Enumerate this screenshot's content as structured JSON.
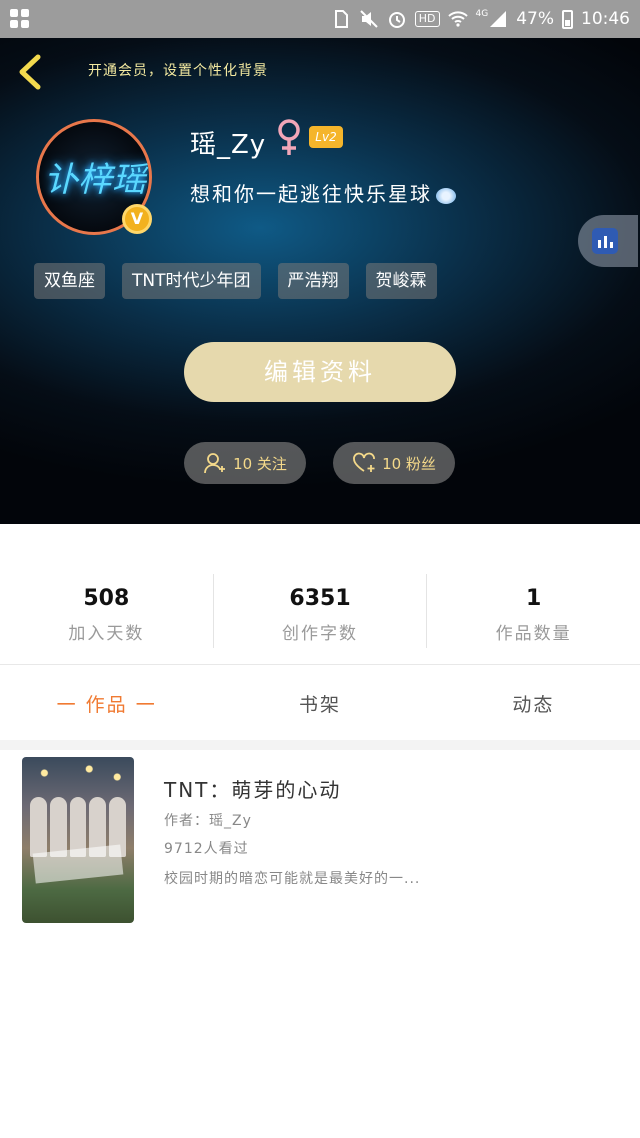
{
  "status_bar": {
    "battery": "47%",
    "time": "10:46",
    "hd": "HD",
    "network": "4G"
  },
  "header": {
    "vip_tip": "开通会员，设置个性化背景"
  },
  "profile": {
    "avatar_text": "讣梓瑶",
    "username": "瑶_Zy",
    "level": "Lv2",
    "bio": "想和你一起逃往快乐星球",
    "vip_badge": "V",
    "tags": [
      "双鱼座",
      "TNT时代少年团",
      "严浩翔",
      "贺峻霖"
    ],
    "edit_label": "编辑资料",
    "follow_label": "10 关注",
    "fans_label": "10 粉丝"
  },
  "stats": [
    {
      "value": "508",
      "label": "加入天数"
    },
    {
      "value": "6351",
      "label": "创作字数"
    },
    {
      "value": "1",
      "label": "作品数量"
    }
  ],
  "tabs": [
    {
      "label": "一 作品 一",
      "active": true
    },
    {
      "label": "书架",
      "active": false
    },
    {
      "label": "动态",
      "active": false
    }
  ],
  "works": [
    {
      "title": "TNT：萌芽的心动",
      "author": "作者：瑶_Zy",
      "views": "9712人看过",
      "desc": "校园时期的暗恋可能就是最美好的一..."
    }
  ],
  "colors": {
    "accent": "#f07a32",
    "edit_button": "#e6d9ad",
    "level_badge": "#f5b52b",
    "pill_text": "#f4d98a"
  }
}
